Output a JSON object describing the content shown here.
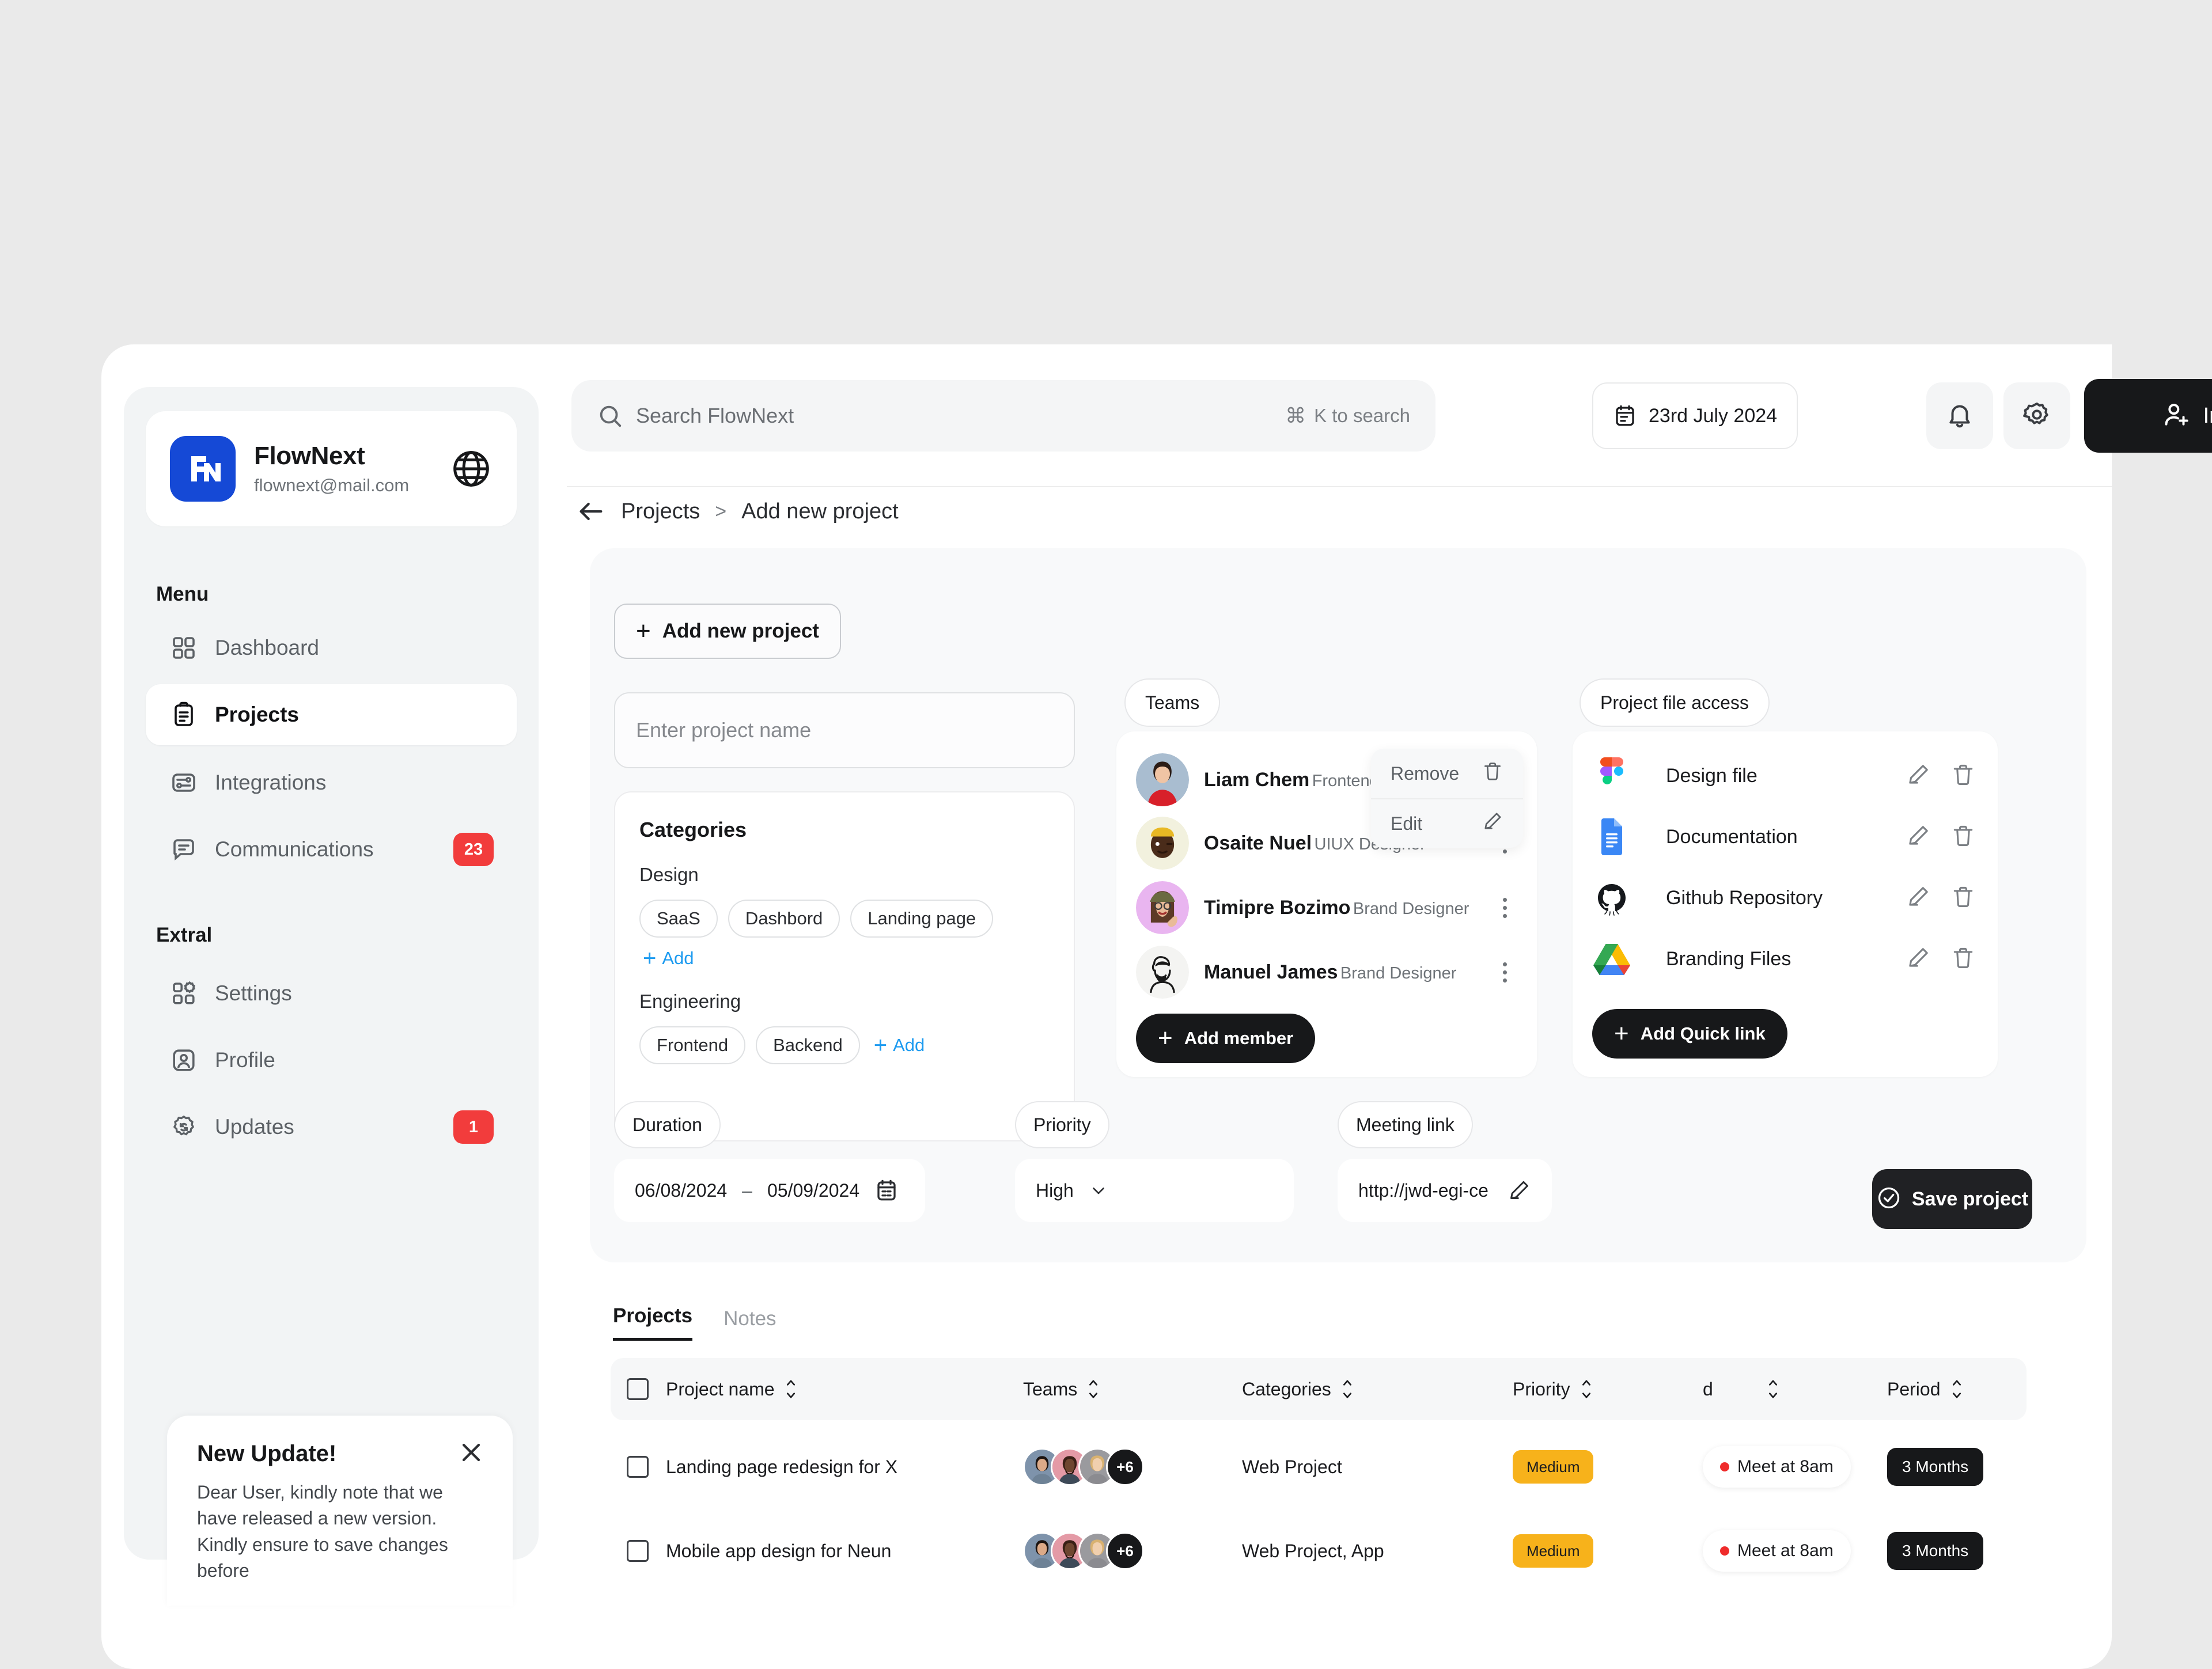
{
  "brand": {
    "name": "FlowNext",
    "email": "flownext@mail.com",
    "logo_text": "FN",
    "logo_color": "#1549d6"
  },
  "sidebar": {
    "menu_label": "Menu",
    "extra_label": "Extral",
    "menu_items": [
      {
        "label": "Dashboard",
        "icon": "grid-icon",
        "badge": ""
      },
      {
        "label": "Projects",
        "icon": "clipboard-icon",
        "badge": "",
        "active": true
      },
      {
        "label": "Integrations",
        "icon": "sliders-icon",
        "badge": ""
      },
      {
        "label": "Communications",
        "icon": "chat-icon",
        "badge": "23"
      }
    ],
    "extra_items": [
      {
        "label": "Settings",
        "icon": "grid-gear-icon",
        "badge": ""
      },
      {
        "label": "Profile",
        "icon": "user-square-icon",
        "badge": ""
      },
      {
        "label": "Updates",
        "icon": "gear-refresh-icon",
        "badge": "1"
      }
    ],
    "badge_color": "#f23c3c"
  },
  "toast": {
    "title": "New Update!",
    "body": "Dear User, kindly note that we have released a new version. Kindly ensure to save changes before",
    "close_icon": "close-icon"
  },
  "topbar": {
    "search_placeholder": "Search FlowNext",
    "search_icon": "search-icon",
    "shortcut_symbol": "⌘",
    "shortcut_hint": "K to search",
    "date": "23rd July 2024",
    "calendar_icon": "calendar-icon",
    "bell_icon": "bell-icon",
    "gear_icon": "gear-icon",
    "invite_label": "Invite",
    "invite_icon": "user-plus-icon"
  },
  "breadcrumb": {
    "back_icon": "arrow-left-icon",
    "parent": "Projects",
    "separator": ">",
    "current": "Add new project"
  },
  "form": {
    "add_new_label": "Add new project",
    "project_name_placeholder": "Enter project name",
    "categories": {
      "title": "Categories",
      "groups": [
        {
          "label": "Design",
          "chips": [
            "SaaS",
            "Dashbord",
            "Landing page"
          ],
          "add_label": "Add"
        },
        {
          "label": "Engineering",
          "chips": [
            "Frontend",
            "Backend"
          ],
          "add_label": "Add"
        }
      ],
      "add_link_color": "#1d9bf0"
    },
    "teams": {
      "pill_label": "Teams",
      "members": [
        {
          "name": "Liam Chem",
          "role": "Frontend Developer",
          "avatar": "avatar-liam"
        },
        {
          "name": "Osaite Nuel",
          "role": "UIUX Designer",
          "avatar": "avatar-osaite"
        },
        {
          "name": "Timipre Bozimo",
          "role": "Brand Designer",
          "avatar": "avatar-timipre"
        },
        {
          "name": "Manuel James",
          "role": "Brand Designer",
          "avatar": "avatar-manuel"
        }
      ],
      "add_member_label": "Add member",
      "context_menu": [
        {
          "label": "Remove",
          "icon": "trash-icon"
        },
        {
          "label": "Edit",
          "icon": "pencil-icon"
        }
      ]
    },
    "files": {
      "pill_label": "Project file access",
      "items": [
        {
          "label": "Design file",
          "icon": "figma-icon"
        },
        {
          "label": "Documentation",
          "icon": "google-docs-icon"
        },
        {
          "label": "Github Repository",
          "icon": "github-icon"
        },
        {
          "label": "Branding Files",
          "icon": "google-drive-icon"
        }
      ],
      "add_quick_link_label": "Add Quick link",
      "edit_icon": "pencil-icon",
      "delete_icon": "trash-icon"
    },
    "duration": {
      "pill_label": "Duration",
      "start": "06/08/2024",
      "dash": "–",
      "end": "05/09/2024",
      "icon": "calendar-icon"
    },
    "priority": {
      "pill_label": "Priority",
      "value": "High",
      "icon": "chevron-down-icon"
    },
    "meeting": {
      "pill_label": "Meeting link",
      "value": "http://jwd-egi-ce",
      "icon": "pencil-icon"
    },
    "save_label": "Save project",
    "save_icon": "check-circle-icon"
  },
  "table": {
    "tabs": [
      {
        "label": "Projects",
        "active": true
      },
      {
        "label": "Notes",
        "active": false
      }
    ],
    "columns": [
      "Project name",
      "Teams",
      "Categories",
      "Priority",
      "d",
      "Period"
    ],
    "sort_icon": "sort-icon",
    "rows": [
      {
        "name": "Landing page redesign for X",
        "team_overflow": "+6",
        "categories": "Web Project",
        "priority": "Medium",
        "meeting": "Meet at 8am",
        "period": "3 Months"
      },
      {
        "name": "Mobile app design for Neun",
        "team_overflow": "+6",
        "categories": "Web Project, App",
        "priority": "Medium",
        "meeting": "Meet at 8am",
        "period": "3 Months"
      }
    ],
    "priority_color": "#f7b21b",
    "period_color": "#17181a",
    "meeting_dot_color": "#ef2b2b"
  }
}
